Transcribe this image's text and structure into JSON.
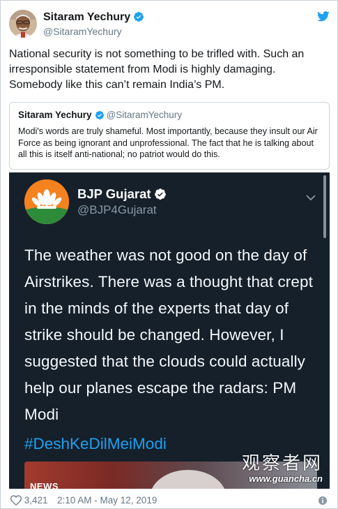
{
  "tweet": {
    "author_name": "Sitaram Yechury",
    "author_handle": "@SitaramYechury",
    "text": "National security is not something to be trifled with. Such an irresponsible statement from Modi is highly damaging. Somebody like this can’t remain India’s PM.",
    "likes": "3,421",
    "timestamp": "2:10 AM - May 12, 2019"
  },
  "quoted": {
    "author_name": "Sitaram Yechury",
    "author_handle": "@SitaramYechury",
    "text": "Modi's words are truly shameful. Most importantly, because they insult our Air Force as being ignorant and unprofessional. The fact that he is talking about all this is itself anti-national; no patriot would do this."
  },
  "media": {
    "author_name": "BJP Gujarat",
    "author_handle": "@BJP4Gujarat",
    "text": "The weather was not good on the day of Airstrikes. There was a thought that crept in the minds of the experts that day of strike should be changed. However, I suggested that the clouds could actually help our planes escape the radars: PM Modi",
    "hashtag": "#DeshKeDilMeiModi",
    "video_label": "NEWS"
  },
  "watermark": {
    "chinese": "观察者网",
    "url": "www.guancha.cn"
  },
  "icons": {
    "verified": "verified-badge-icon",
    "twitter": "twitter-bird-icon",
    "like": "heart-icon",
    "info": "info-icon",
    "chevron": "chevron-down-icon"
  },
  "colors": {
    "twitter_blue": "#1da1f2",
    "secondary_text": "#657786",
    "media_background": "#15202b"
  }
}
